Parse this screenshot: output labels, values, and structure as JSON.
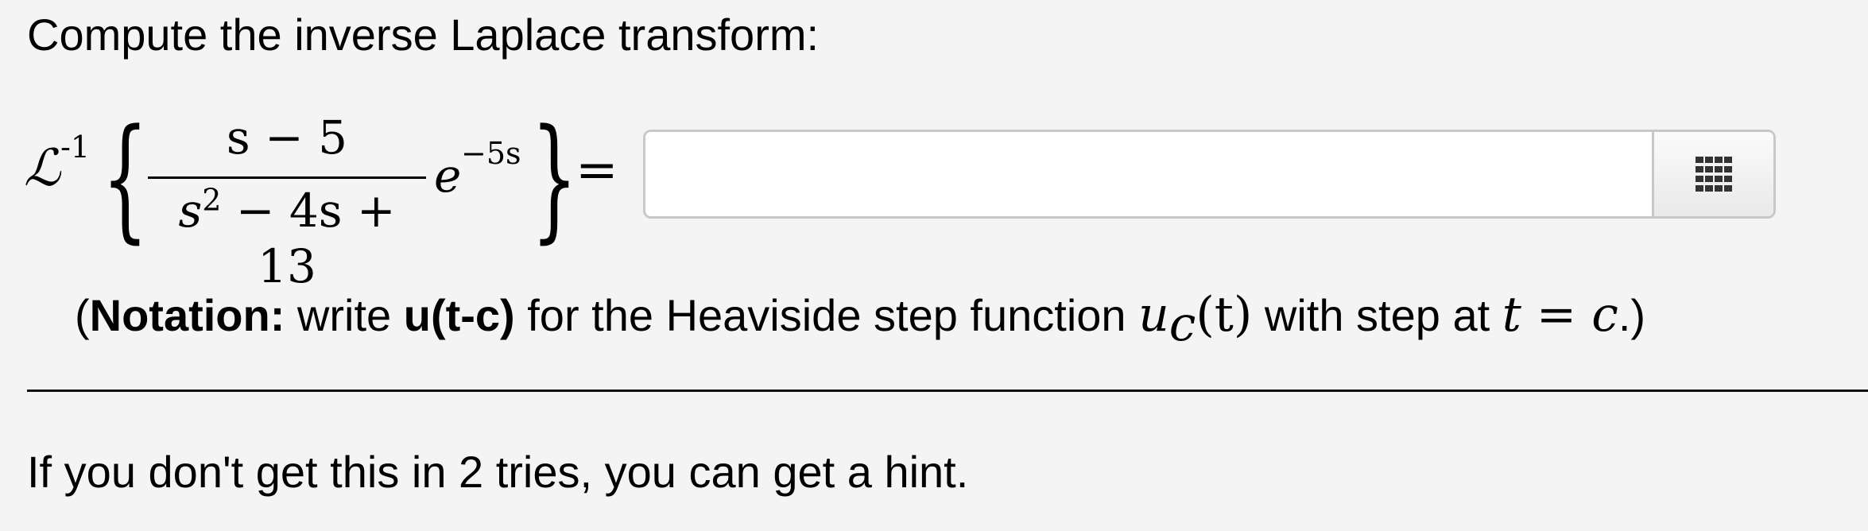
{
  "prompt": "Compute the inverse Laplace transform:",
  "equation": {
    "operator": "ℒ",
    "operator_sup": "-1",
    "left_brace": "{",
    "right_brace": "}",
    "numerator": "s − 5",
    "denominator_base": "s",
    "denominator_sup": "2",
    "denominator_rest": " − 4s + 13",
    "exp_base": "e",
    "exp_power": "−5s",
    "equals": "="
  },
  "answer": {
    "value": "",
    "placeholder": ""
  },
  "palette": {
    "icon": "grid-icon"
  },
  "notation": {
    "open_paren": "(",
    "label": "Notation:",
    "text_1": " write ",
    "code": "u(t-c)",
    "text_2": " for the Heaviside step function ",
    "func_u": "u",
    "func_sub": "c",
    "func_arg": "(t)",
    "text_3": " with step at ",
    "condition": "t = c",
    "close": ".)"
  },
  "hint": "If you don't get this in 2 tries, you can get a hint."
}
